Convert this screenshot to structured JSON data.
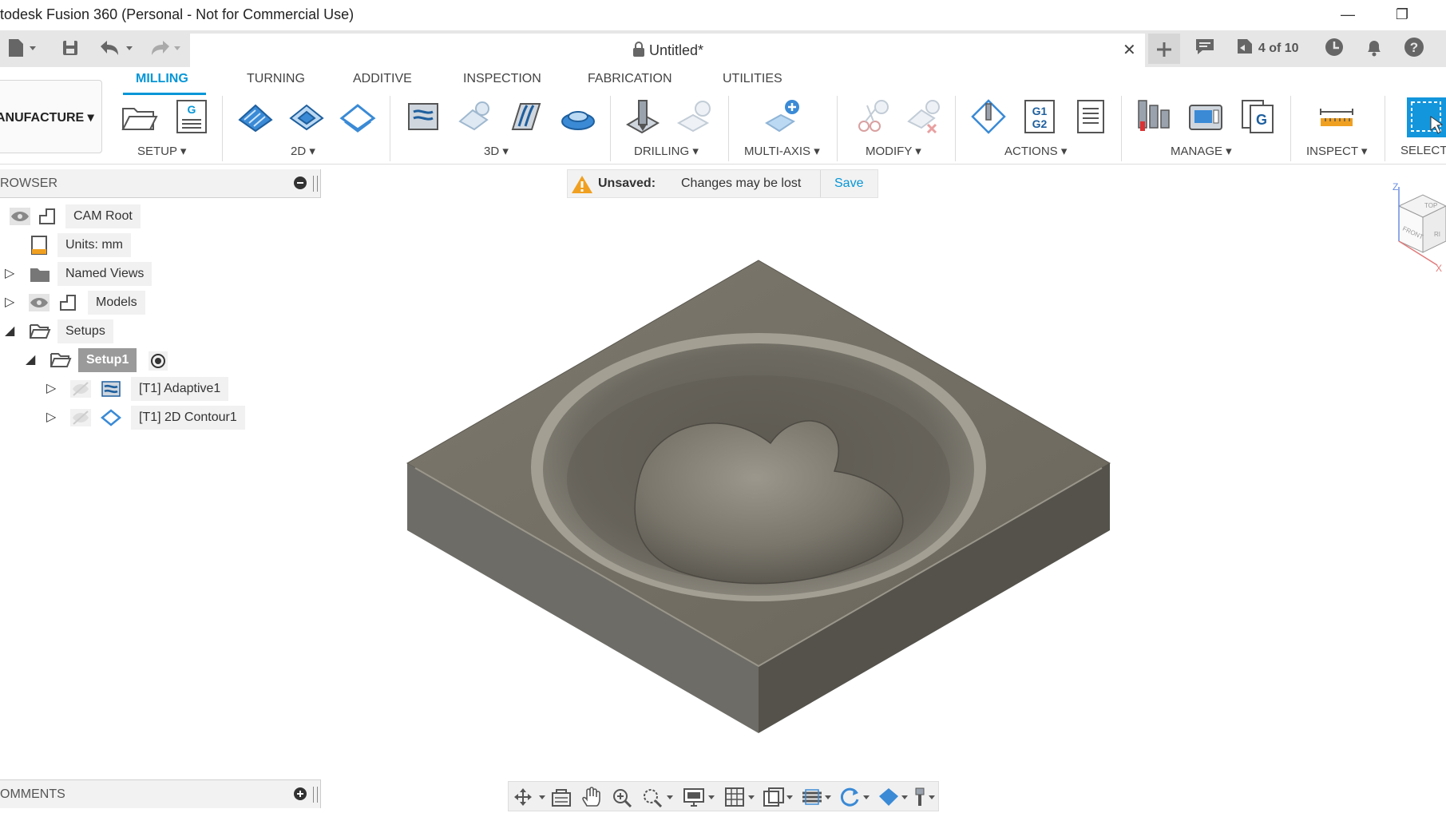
{
  "window": {
    "title": "todesk Fusion 360 (Personal - Not for Commercial Use)",
    "minimize_glyph": "—",
    "restore_glyph": "❐"
  },
  "tabbar": {
    "document_title": "Untitled*",
    "job_status": "4 of 10"
  },
  "workspace": {
    "label": "ANUFACTURE"
  },
  "ribbon_tabs": [
    "MILLING",
    "TURNING",
    "ADDITIVE",
    "INSPECTION",
    "FABRICATION",
    "UTILITIES"
  ],
  "ribbon_groups": [
    "SETUP",
    "2D",
    "3D",
    "DRILLING",
    "MULTI-AXIS",
    "MODIFY",
    "ACTIONS",
    "MANAGE",
    "INSPECT",
    "SELECT"
  ],
  "browser": {
    "title": "ROWSER",
    "nodes": [
      "CAM Root",
      "Units: mm",
      "Named Views",
      "Models",
      "Setups",
      "Setup1",
      "[T1] Adaptive1",
      "[T1] 2D Contour1"
    ]
  },
  "unsaved": {
    "label": "Unsaved:",
    "message": "Changes may be lost",
    "save": "Save"
  },
  "comments": {
    "title": "OMMENTS"
  },
  "viewcube": {
    "top": "TOP",
    "front": "FRONT",
    "right": "RI",
    "z": "Z",
    "x": "X"
  },
  "colors": {
    "accent": "#0696d7",
    "model": "#6e6a60",
    "warning": "#f0a020"
  }
}
